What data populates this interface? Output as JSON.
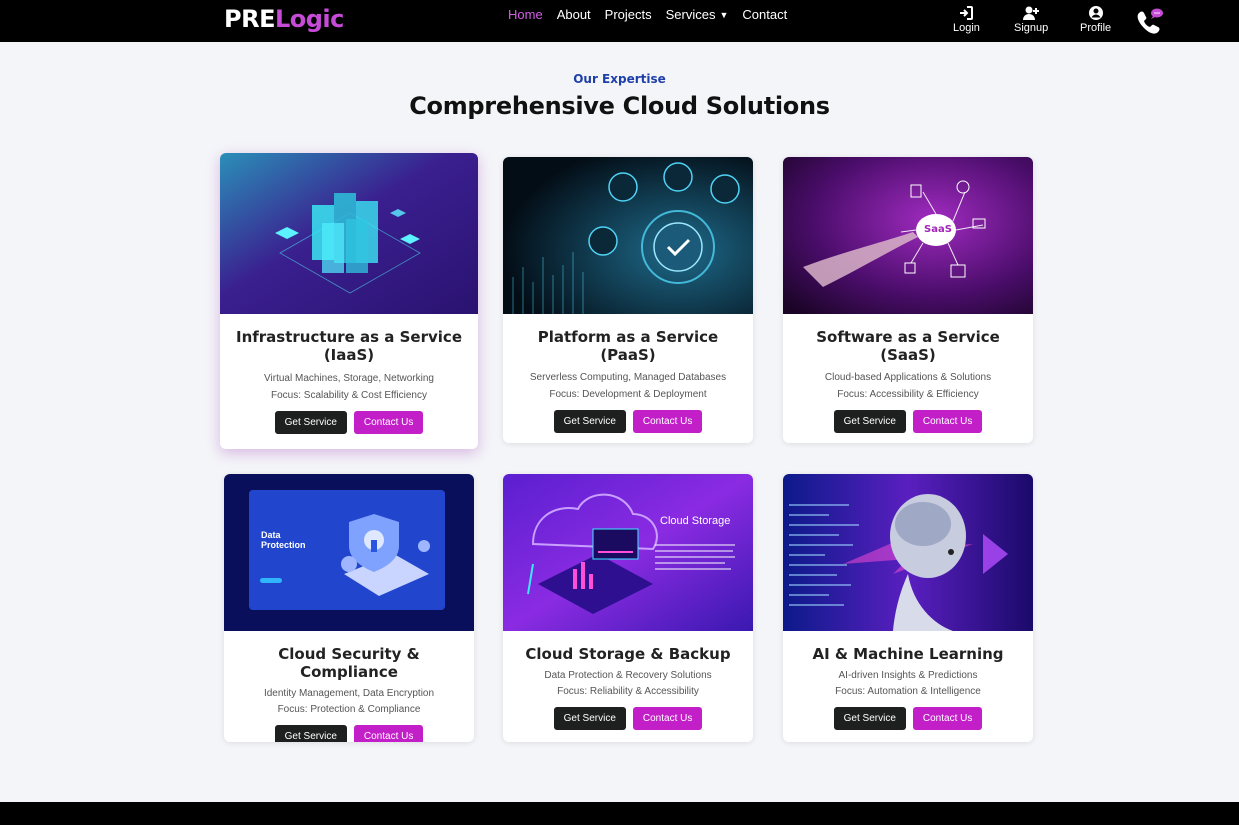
{
  "brand": {
    "part1": "PRE",
    "part2": "Logic"
  },
  "nav": {
    "links": [
      {
        "label": "Home"
      },
      {
        "label": "About"
      },
      {
        "label": "Projects"
      },
      {
        "label": "Services"
      },
      {
        "label": "Contact"
      }
    ],
    "actions": {
      "login": "Login",
      "signup": "Signup",
      "profile": "Profile"
    }
  },
  "section": {
    "eyebrow": "Our Expertise",
    "heading": "Comprehensive Cloud Solutions"
  },
  "cards": [
    {
      "title1": "Infrastructure as a Service",
      "title2": "(IaaS)",
      "line1": "Virtual Machines, Storage, Networking",
      "line2": "Focus: Scalability & Cost Efficiency",
      "btn1": "Get Service",
      "btn2": "Contact Us"
    },
    {
      "title1": "Platform as a Service",
      "title2": "(PaaS)",
      "line1": "Serverless Computing, Managed Databases",
      "line2": "Focus: Development & Deployment",
      "btn1": "Get Service",
      "btn2": "Contact Us"
    },
    {
      "title1": "Software as a Service",
      "title2": "(SaaS)",
      "line1": "Cloud-based Applications & Solutions",
      "line2": "Focus: Accessibility & Efficiency",
      "btn1": "Get Service",
      "btn2": "Contact Us"
    },
    {
      "title1": "Cloud Security & Compliance",
      "line1": "Identity Management, Data Encryption",
      "line2": "Focus: Protection & Compliance",
      "btn1": "Get Service",
      "btn2": "Contact Us"
    },
    {
      "title1": "Cloud Storage & Backup",
      "line1": "Data Protection & Recovery Solutions",
      "line2": "Focus: Reliability & Accessibility",
      "btn1": "Get Service",
      "btn2": "Contact Us"
    },
    {
      "title1": "AI & Machine Learning",
      "line1": "AI-driven Insights & Predictions",
      "line2": "Focus: Automation & Intelligence",
      "btn1": "Get Service",
      "btn2": "Contact Us"
    }
  ],
  "image_text": {
    "saas": "SaaS",
    "data_protection_1": "Data",
    "data_protection_2": "Protection",
    "cloud_storage": "Cloud Storage"
  },
  "colors": {
    "accent": "#c31fc9",
    "brand_logic": "#c64bd6",
    "active_link": "#d45ee8",
    "eyebrow": "#1f3fa8"
  }
}
